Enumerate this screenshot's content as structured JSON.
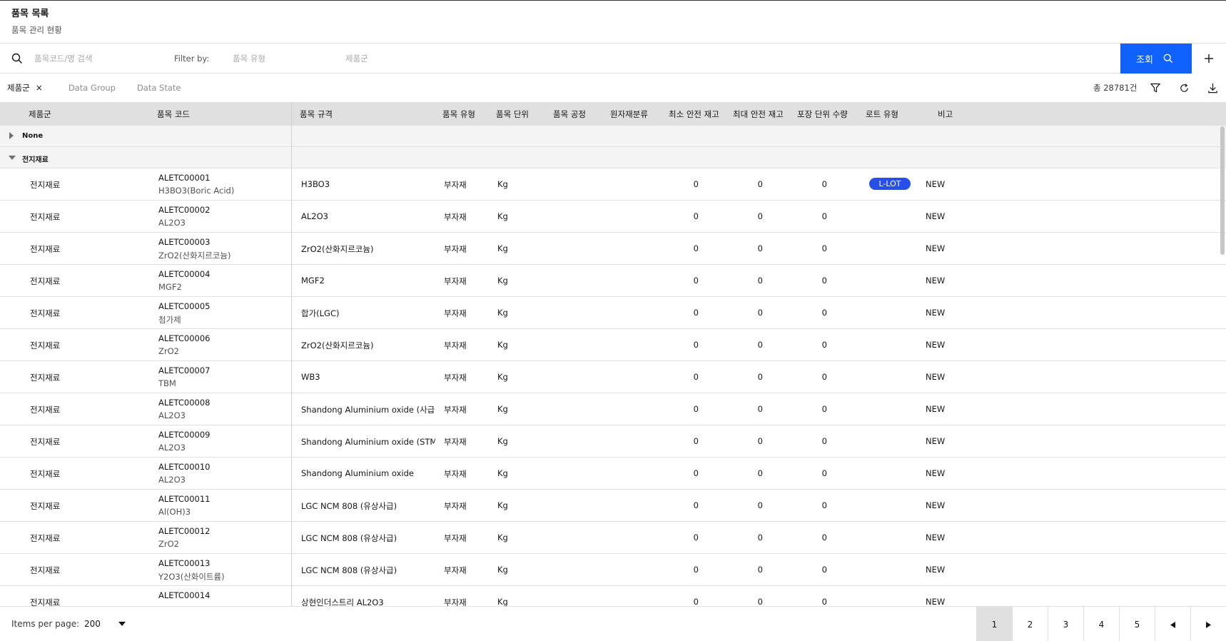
{
  "header": {
    "title": "품목 목록",
    "subtitle": "품목 관리 현황"
  },
  "search": {
    "search_placeholder": "품목코드/명 검색",
    "filter_label": "Filter by:",
    "type_placeholder": "품목 유형",
    "group_placeholder": "제품군",
    "search_button": "조회"
  },
  "toolbar": {
    "chip_label": "제품군",
    "chip_close": "×",
    "tabs": [
      "Data Group",
      "Data State"
    ],
    "total": "총 28781건"
  },
  "table": {
    "columns": [
      "제품군",
      "품목 코드",
      "품목 규격",
      "품목 유형",
      "품목 단위",
      "품목 공정",
      "원자재분류",
      "최소 안전 재고",
      "최대 안전 재고",
      "포장 단위 수량",
      "로트 유형",
      "비고"
    ],
    "groups": [
      {
        "label": "None",
        "expanded": false
      },
      {
        "label": "전지재료",
        "expanded": true
      }
    ],
    "rows": [
      {
        "group": "전지재료",
        "code": "ALETC00001",
        "name": "H3BO3(Boric Acid)",
        "spec": "H3BO3",
        "type": "부자재",
        "unit": "Kg",
        "min": "0",
        "max": "0",
        "pack": "0",
        "lot": "L-LOT",
        "note": "NEW"
      },
      {
        "group": "전지재료",
        "code": "ALETC00002",
        "name": "AL2O3",
        "spec": "AL2O3",
        "type": "부자재",
        "unit": "Kg",
        "min": "0",
        "max": "0",
        "pack": "0",
        "lot": "",
        "note": "NEW"
      },
      {
        "group": "전지재료",
        "code": "ALETC00003",
        "name": "ZrO2(산화지르코늄)",
        "spec": "ZrO2(산화지르코늄)",
        "type": "부자재",
        "unit": "Kg",
        "min": "0",
        "max": "0",
        "pack": "0",
        "lot": "",
        "note": "NEW"
      },
      {
        "group": "전지재료",
        "code": "ALETC00004",
        "name": "MGF2",
        "spec": "MGF2",
        "type": "부자재",
        "unit": "Kg",
        "min": "0",
        "max": "0",
        "pack": "0",
        "lot": "",
        "note": "NEW"
      },
      {
        "group": "전지재료",
        "code": "ALETC00005",
        "name": "첨가제",
        "spec": "합가(LGC)",
        "type": "부자재",
        "unit": "Kg",
        "min": "0",
        "max": "0",
        "pack": "0",
        "lot": "",
        "note": "NEW"
      },
      {
        "group": "전지재료",
        "code": "ALETC00006",
        "name": "ZrO2",
        "spec": "ZrO2(산화지르코늄)",
        "type": "부자재",
        "unit": "Kg",
        "min": "0",
        "max": "0",
        "pack": "0",
        "lot": "",
        "note": "NEW"
      },
      {
        "group": "전지재료",
        "code": "ALETC00007",
        "name": "TBM",
        "spec": "WB3",
        "type": "부자재",
        "unit": "Kg",
        "min": "0",
        "max": "0",
        "pack": "0",
        "lot": "",
        "note": "NEW"
      },
      {
        "group": "전지재료",
        "code": "ALETC00008",
        "name": "AL2O3",
        "spec": "Shandong Aluminium oxide (사급)",
        "type": "부자재",
        "unit": "Kg",
        "min": "0",
        "max": "0",
        "pack": "0",
        "lot": "",
        "note": "NEW"
      },
      {
        "group": "전지재료",
        "code": "ALETC00009",
        "name": "AL2O3",
        "spec": "Shandong Aluminium oxide (STM 독",
        "type": "부자재",
        "unit": "Kg",
        "min": "0",
        "max": "0",
        "pack": "0",
        "lot": "",
        "note": "NEW"
      },
      {
        "group": "전지재료",
        "code": "ALETC00010",
        "name": "AL2O3",
        "spec": "Shandong Aluminium oxide",
        "type": "부자재",
        "unit": "Kg",
        "min": "0",
        "max": "0",
        "pack": "0",
        "lot": "",
        "note": "NEW"
      },
      {
        "group": "전지재료",
        "code": "ALETC00011",
        "name": "Al(OH)3",
        "spec": "LGC NCM 808 (유상사급)",
        "type": "부자재",
        "unit": "Kg",
        "min": "0",
        "max": "0",
        "pack": "0",
        "lot": "",
        "note": "NEW"
      },
      {
        "group": "전지재료",
        "code": "ALETC00012",
        "name": "ZrO2",
        "spec": "LGC NCM 808 (유상사급)",
        "type": "부자재",
        "unit": "Kg",
        "min": "0",
        "max": "0",
        "pack": "0",
        "lot": "",
        "note": "NEW"
      },
      {
        "group": "전지재료",
        "code": "ALETC00013",
        "name": "Y2O3(산화이트륨)",
        "spec": "LGC NCM 808 (유상사급)",
        "type": "부자재",
        "unit": "Kg",
        "min": "0",
        "max": "0",
        "pack": "0",
        "lot": "",
        "note": "NEW"
      },
      {
        "group": "전지재료",
        "code": "ALETC00014",
        "name": "",
        "spec": "상현인더스트리 AL2O3",
        "type": "부자재",
        "unit": "Kg",
        "min": "0",
        "max": "0",
        "pack": "0",
        "lot": "",
        "note": "NEW"
      }
    ]
  },
  "footer": {
    "items_per_page_label": "Items per page:",
    "items_per_page": "200",
    "pages": [
      "1",
      "2",
      "3",
      "4",
      "5"
    ],
    "current_page": "1"
  },
  "colors": {
    "primary": "#0f62fe",
    "badge": "#2850e6",
    "header_bg": "#e0e0e0"
  }
}
